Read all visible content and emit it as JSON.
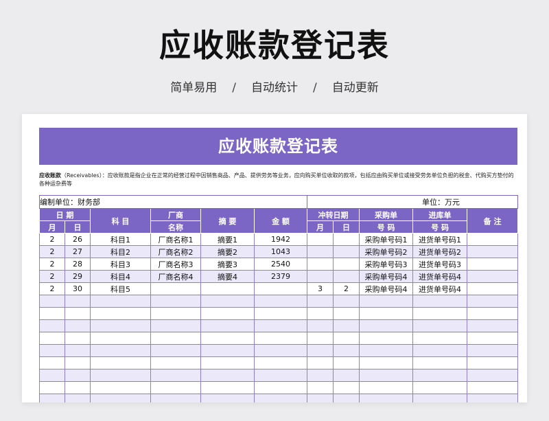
{
  "hero": {
    "title": "应收账款登记表",
    "tags": [
      "简单易用",
      "自动统计",
      "自动更新"
    ],
    "separator": "/"
  },
  "sheet": {
    "banner_title": "应收账款登记表",
    "desc_term": "应收账款",
    "desc_text": "（Receivables）：应收账款是指企业在正常的经营过程中因销售商品、产品、提供劳务等业务，应向购买单位收取的款项，包括应由购买单位或接受劳务单位负担的税金、代购买方垫付的各种运杂费等",
    "unit_left": "编制单位：财务部",
    "unit_right": "单位：万元",
    "headers": {
      "date": "日 期",
      "month": "月",
      "day": "日",
      "subject": "科 目",
      "vendor_top": "厂商",
      "vendor_bottom": "名称",
      "summary": "摘 要",
      "amount": "金 额",
      "offset_date": "冲转日期",
      "offset_month": "月",
      "offset_day": "日",
      "po_top": "采购单",
      "po_bottom": "号 码",
      "gr_top": "进库单",
      "gr_bottom": "号 码",
      "remark": "备 注"
    },
    "rows": [
      [
        "2",
        "26",
        "科目1",
        "厂商名称1",
        "摘要1",
        "1942",
        "",
        "",
        "采购单号码1",
        "进货单号码1",
        ""
      ],
      [
        "2",
        "27",
        "科目2",
        "厂商名称2",
        "摘要2",
        "1043",
        "",
        "",
        "采购单号码2",
        "进货单号码2",
        ""
      ],
      [
        "2",
        "28",
        "科目3",
        "厂商名称3",
        "摘要3",
        "2540",
        "",
        "",
        "采购单号码3",
        "进货单号码3",
        ""
      ],
      [
        "2",
        "29",
        "科目4",
        "厂商名称4",
        "摘要4",
        "2379",
        "",
        "",
        "采购单号码4",
        "进货单号码4",
        ""
      ],
      [
        "2",
        "30",
        "科目5",
        "",
        "",
        "",
        "3",
        "2",
        "采购单号码4",
        "进货单号码4",
        ""
      ]
    ],
    "empty_rows": 9
  }
}
